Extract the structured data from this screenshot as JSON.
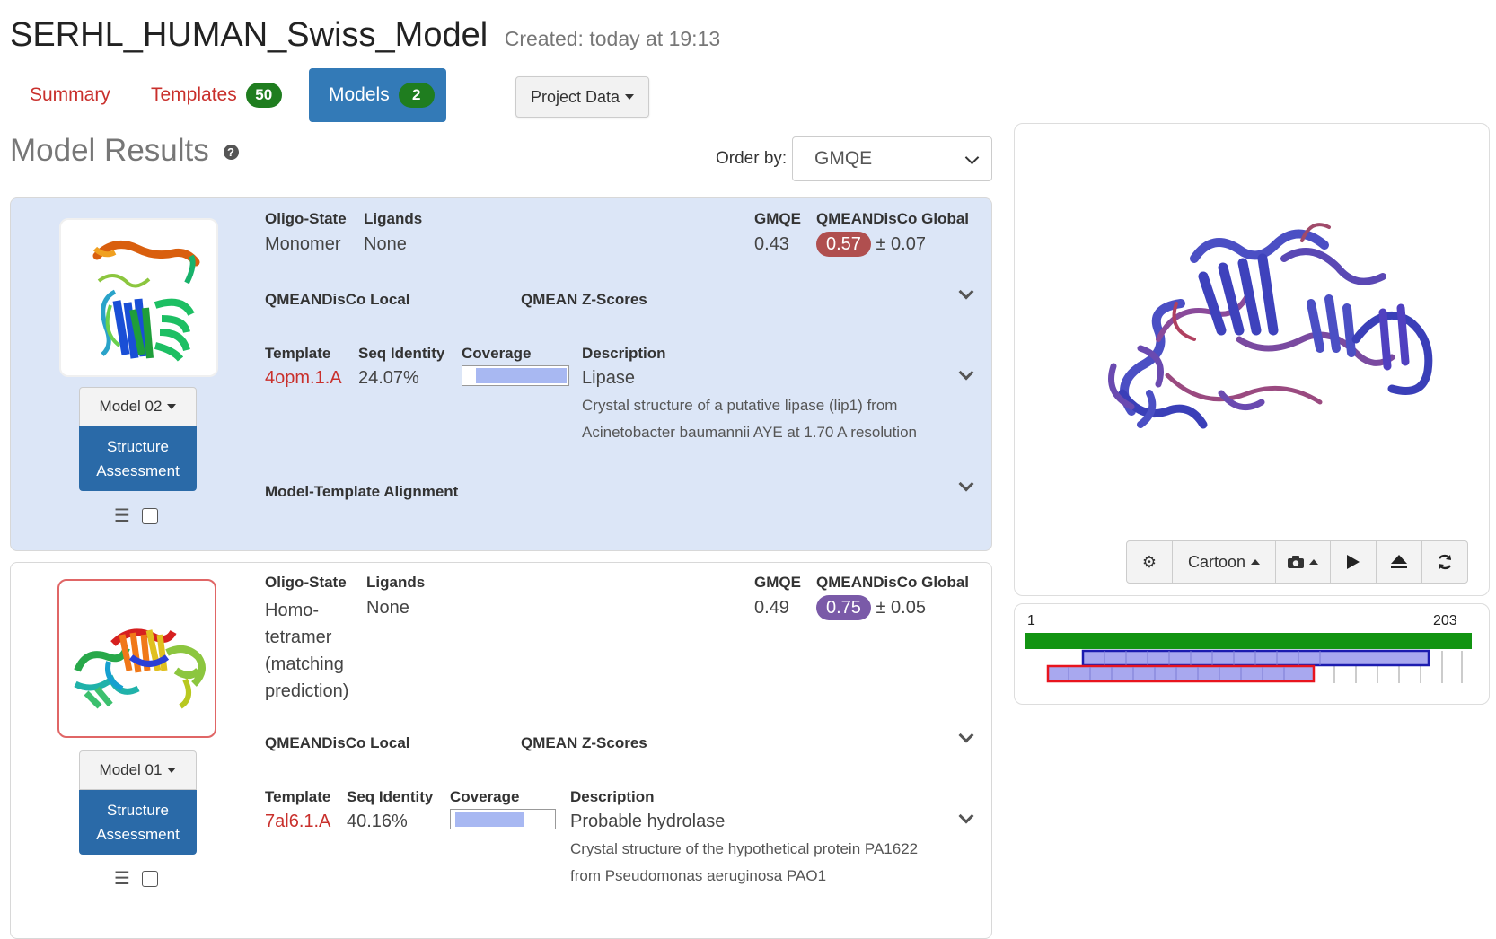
{
  "header": {
    "title": "SERHL_HUMAN_Swiss_Model",
    "created": "Created: today at 19:13"
  },
  "tabs": [
    {
      "label": "Summary",
      "badge": null
    },
    {
      "label": "Templates",
      "badge": "50"
    },
    {
      "label": "Models",
      "badge": "2"
    }
  ],
  "project_data": {
    "label": "Project Data"
  },
  "results": {
    "title": "Model Results",
    "order_by_label": "Order by:",
    "order_by_value": "GMQE"
  },
  "labels": {
    "oligo_state": "Oligo-State",
    "ligands": "Ligands",
    "gmqe": "GMQE",
    "qmean_global": "QMEANDisCo Global",
    "qmean_local": "QMEANDisCo Local",
    "qmean_z": "QMEAN Z-Scores",
    "template": "Template",
    "seq_identity": "Seq Identity",
    "coverage": "Coverage",
    "description": "Description",
    "alignment": "Model-Template Alignment",
    "assessment": "Structure Assessment"
  },
  "models": [
    {
      "button": "Model 02",
      "oligo_state": "Monomer",
      "ligands": "None",
      "gmqe": "0.43",
      "qmean_score": "0.57",
      "qmean_err": "± 0.07",
      "qmean_color": "#b04f4f",
      "template": "4opm.1.A",
      "seq_identity": "24.07%",
      "coverage_start": 0.13,
      "coverage_end": 0.98,
      "description_title": "Lipase",
      "description_lines": [
        "Crystal structure of a putative lipase (lip1) from",
        "Acinetobacter baumannii AYE at 1.70 A resolution"
      ]
    },
    {
      "button": "Model 01",
      "oligo_state_lines": [
        "Homo-",
        "tetramer",
        "(matching",
        "prediction)"
      ],
      "ligands": "None",
      "gmqe": "0.49",
      "qmean_score": "0.75",
      "qmean_err": "± 0.05",
      "qmean_color": "#7a5aa8",
      "template": "7al6.1.A",
      "seq_identity": "40.16%",
      "coverage_start": 0.04,
      "coverage_end": 0.7,
      "description_title": "Probable hydrolase",
      "description_lines": [
        "Crystal structure of the hypothetical protein PA1622",
        "from Pseudomonas aeruginosa PAO1"
      ]
    }
  ],
  "viewer": {
    "style_label": "Cartoon",
    "icons": [
      "gear-icon",
      "camera-icon",
      "play-icon",
      "eject-icon",
      "refresh-icon"
    ]
  },
  "sequence": {
    "start": "1",
    "end": "203"
  },
  "colors": {
    "accent": "#337ab7",
    "link_red": "#c9302c",
    "badge_green": "#1f7d1f",
    "seq_green": "#129412",
    "align_blue": "#1c1cb0",
    "align_red": "#e8141e",
    "align_fill": "#a8a8ef"
  }
}
